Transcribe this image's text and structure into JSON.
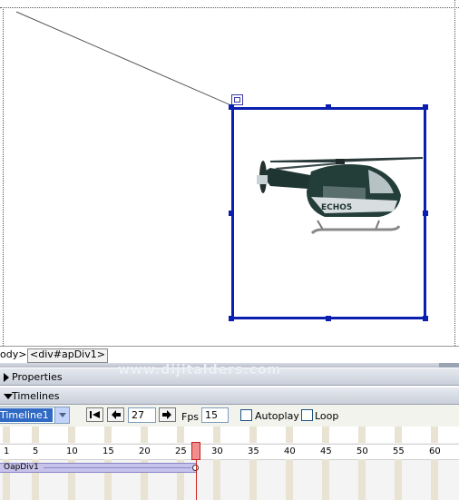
{
  "tag_selector": {
    "body_tag": "ody>",
    "div_tag": "<div#apDiv1>"
  },
  "panels": {
    "properties_label": "Properties",
    "timelines_label": "Timelines",
    "watermark": "www.dijitalders.com"
  },
  "timeline": {
    "selected_timeline": "Timeline1",
    "current_frame": "27",
    "fps_label": "Fps",
    "fps_value": "15",
    "autoplay_label": "Autoplay",
    "autoplay_checked": false,
    "loop_label": "Loop",
    "loop_checked": false,
    "frame_numbers": [
      "1",
      "5",
      "10",
      "15",
      "20",
      "25",
      "30",
      "35",
      "40",
      "45",
      "50",
      "55",
      "60"
    ],
    "animation_track_label": "OapDiv1",
    "keyframe_end": 27
  },
  "icons": {
    "rewind": "rewind-to-start-icon",
    "back": "step-back-icon",
    "forward": "step-forward-icon",
    "dropdown": "chevron-down-icon"
  },
  "colors": {
    "apdiv_border": "#0a1fb0",
    "playhead": "#f18d8d",
    "animation_bar": "#c7c3ea",
    "selection": "#316ac5"
  }
}
